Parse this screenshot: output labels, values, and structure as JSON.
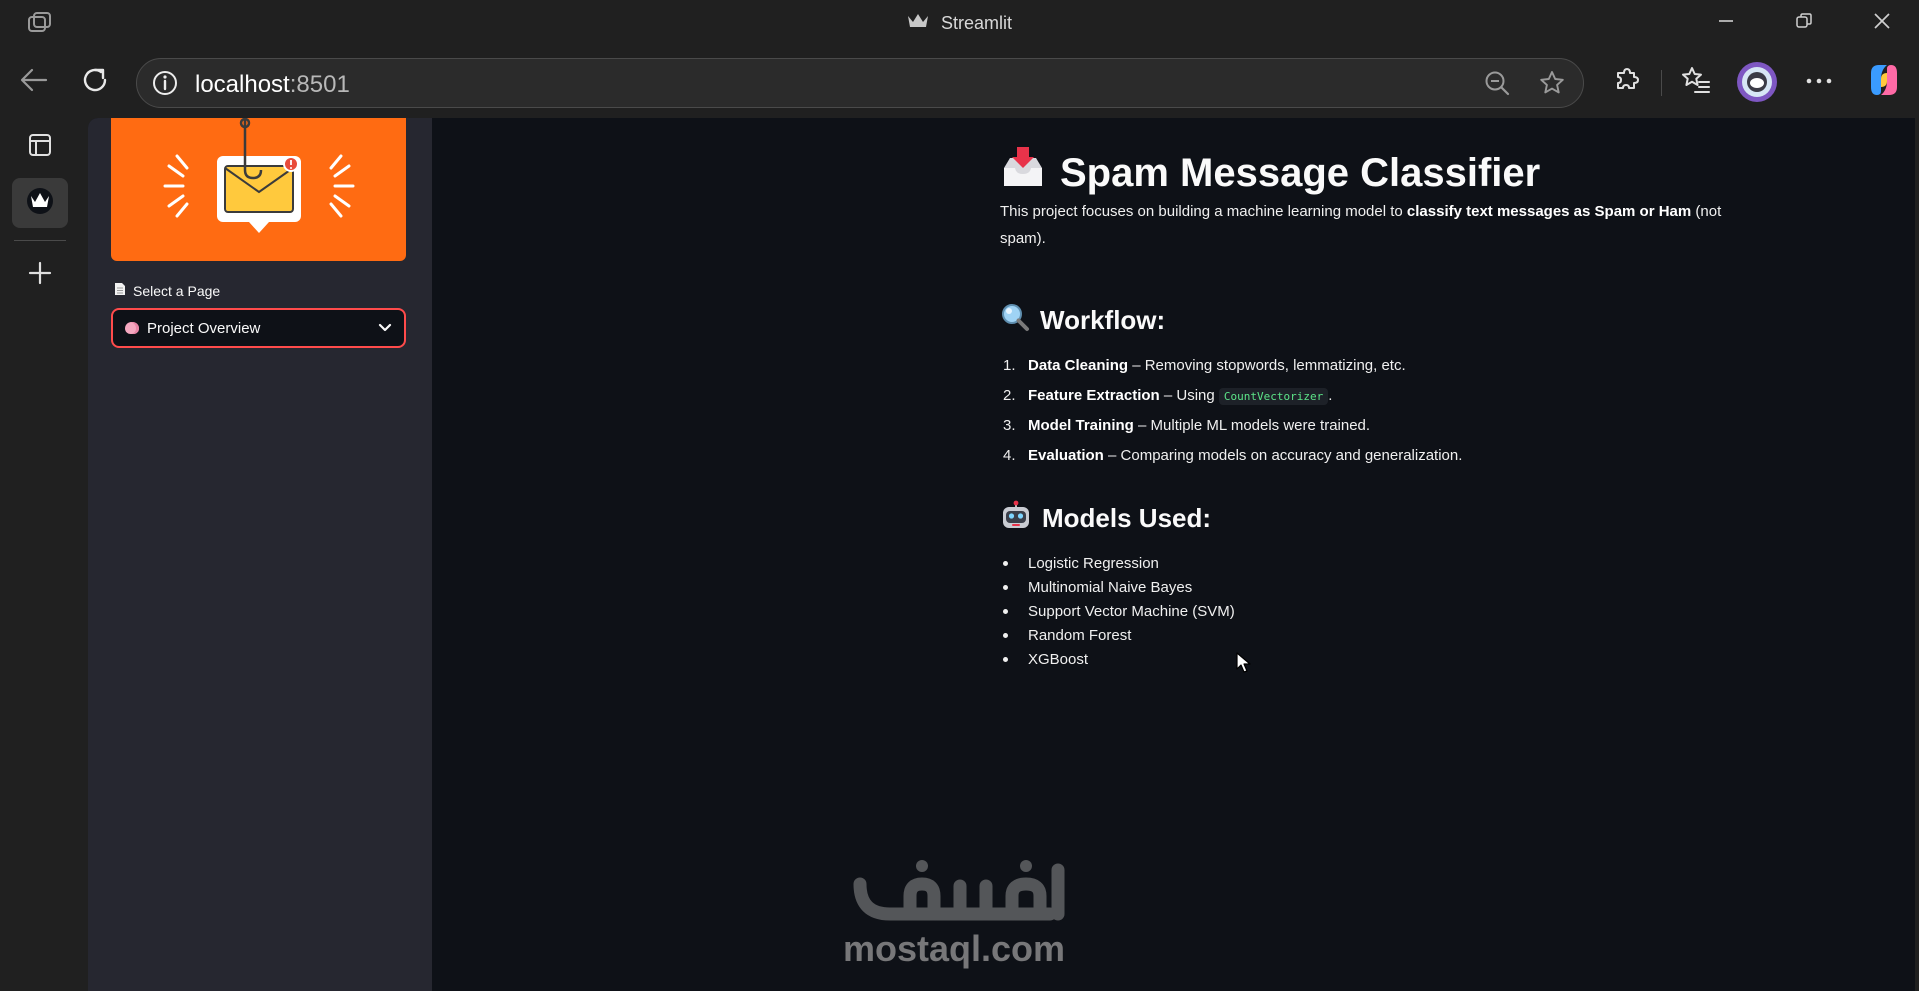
{
  "window": {
    "title": "Streamlit"
  },
  "toolbar": {
    "url_host": "localhost",
    "url_port": ":8501"
  },
  "sidebar": {
    "select_label": "Select a Page",
    "selected_page": "Project Overview"
  },
  "main": {
    "title": "Spam Message Classifier",
    "intro_prefix": "This project focuses on building a machine learning model to ",
    "intro_bold": "classify text messages as Spam or Ham",
    "intro_suffix": " (not spam).",
    "workflow": {
      "heading": "Workflow:",
      "items": [
        {
          "num": "1.",
          "bold": "Data Cleaning",
          "text": " – Removing stopwords, lemmatizing, etc."
        },
        {
          "num": "2.",
          "bold": "Feature Extraction",
          "text": " – Using ",
          "code": "CountVectorizer",
          "after": "."
        },
        {
          "num": "3.",
          "bold": "Model Training",
          "text": " – Multiple ML models were trained."
        },
        {
          "num": "4.",
          "bold": "Evaluation",
          "text": " – Comparing models on accuracy and generalization."
        }
      ]
    },
    "models": {
      "heading": "Models Used:",
      "items": [
        "Logistic Regression",
        "Multinomial Naive Bayes",
        "Support Vector Machine (SVM)",
        "Random Forest",
        "XGBoost"
      ]
    }
  },
  "watermark": {
    "text": "mostaql.com"
  },
  "colors": {
    "page_bg": "#0e1117",
    "sidebar_bg": "#262730",
    "banner_bg": "#ff6b12",
    "select_border": "#ff4b4b",
    "code_text": "#5ce488"
  },
  "icons": {
    "app": "browser-app-icon",
    "title": "streamlit-crown-icon",
    "minimize": "minimize-icon",
    "restore": "restore-icon",
    "close": "close-icon",
    "back": "back-arrow-icon",
    "refresh": "refresh-icon",
    "info": "info-icon",
    "zoom": "zoom-out-icon",
    "favorite": "star-icon",
    "extensions": "puzzle-icon",
    "favorites_list": "favorites-list-icon",
    "profile": "profile-avatar",
    "menu": "more-menu-icon",
    "copilot": "copilot-icon",
    "tabs": "tab-actions-icon",
    "rail_app": "streamlit-app-icon",
    "add": "plus-icon",
    "page_doc": "document-icon",
    "chevron": "chevron-down-icon",
    "inbox": "inbox-tray-icon",
    "search": "magnifier-icon",
    "robot": "robot-icon",
    "cursor": "mouse-cursor"
  }
}
